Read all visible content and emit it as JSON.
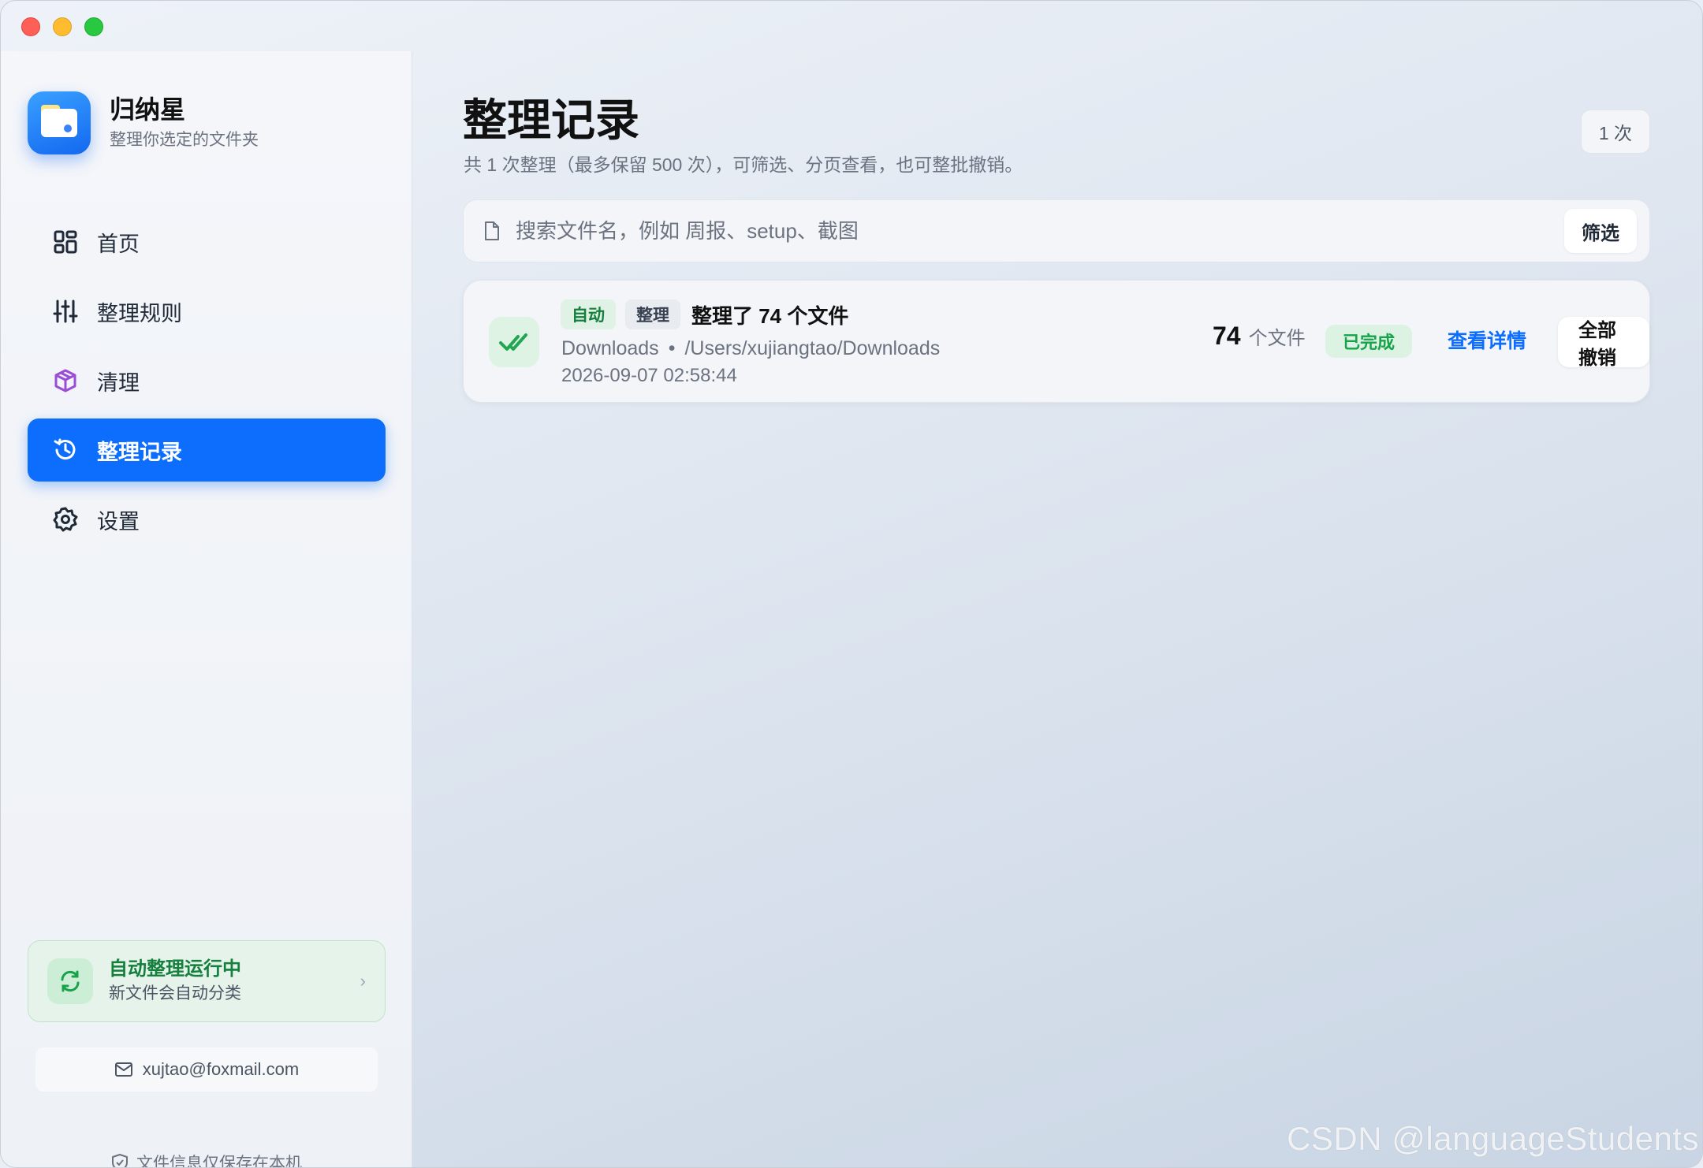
{
  "app": {
    "name": "归纳星",
    "tagline": "整理你选定的文件夹"
  },
  "sidebar": {
    "items": [
      {
        "label": "首页",
        "icon": "grid-icon"
      },
      {
        "label": "整理规则",
        "icon": "sliders-icon"
      },
      {
        "label": "清理",
        "icon": "cube-icon"
      },
      {
        "label": "整理记录",
        "icon": "history-icon",
        "active": true
      },
      {
        "label": "设置",
        "icon": "gear-icon"
      }
    ],
    "auto_status": {
      "title": "自动整理运行中",
      "subtitle": "新文件会自动分类",
      "chevron": "›"
    },
    "email": "xujtao@foxmail.com",
    "privacy_note": "文件信息仅保存在本机"
  },
  "main": {
    "title": "整理记录",
    "subtitle": "共 1 次整理（最多保留 500 次），可筛选、分页查看，也可整批撤销。",
    "count_badge": "1 次",
    "search": {
      "placeholder": "搜索文件名，例如 周报、setup、截图",
      "value": "",
      "filter_label": "筛选"
    },
    "records": [
      {
        "tag_mode": "自动",
        "tag_type": "整理",
        "title": "整理了 74 个文件",
        "folder": "Downloads",
        "separator": "•",
        "path": "/Users/xujiangtao/Downloads",
        "time": "2026-09-07 02:58:44",
        "file_count": "74",
        "file_unit": "个文件",
        "status": "已完成",
        "detail_label": "查看详情",
        "undo_label": "全部撤销"
      }
    ]
  },
  "watermark": "CSDN @languageStudents",
  "colors": {
    "accent": "#0d6efd",
    "success": "#16a34a",
    "success_bg": "#dcf2e3"
  }
}
